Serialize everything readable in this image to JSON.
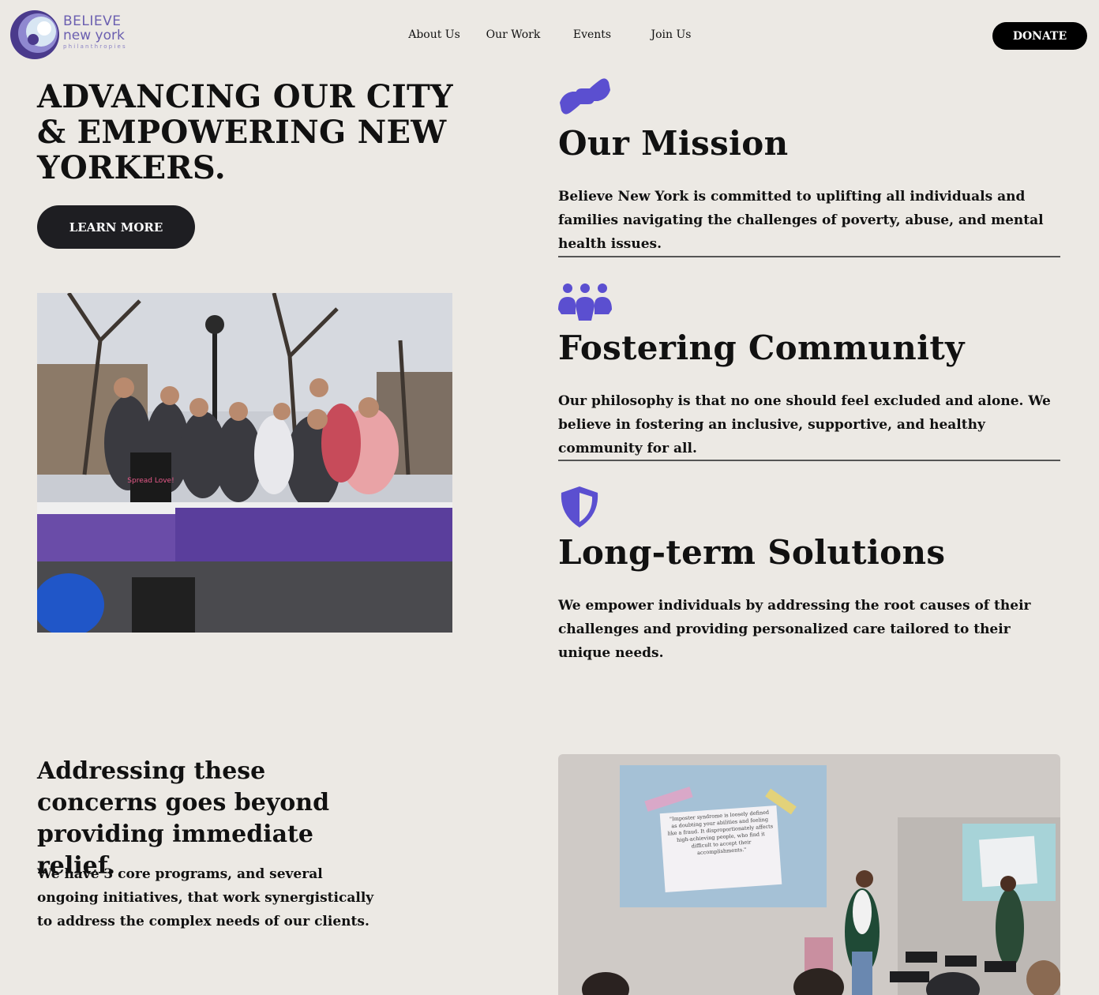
{
  "brand": {
    "line1": "BELIEVE",
    "line2": "new york",
    "line3": "philanthropies",
    "accent_color": "#6b5fb0",
    "icon_color": "#5b4fd0"
  },
  "nav": {
    "items": [
      {
        "label": "About Us"
      },
      {
        "label": "Our Work"
      },
      {
        "label": "Events"
      },
      {
        "label": "Join Us"
      }
    ],
    "donate_label": "DONATE"
  },
  "hero": {
    "title": "ADVANCING OUR CITY & EMPOWERING NEW YORKERS.",
    "button_label": "LEARN MORE",
    "photo_icon": "group-photo-image",
    "sign_text": "Spread Love!"
  },
  "features": [
    {
      "icon": "handshake-icon",
      "title": "Our Mission",
      "body": "Believe New York is committed to uplifting all individuals and families navigating the challenges of poverty, abuse, and mental health issues."
    },
    {
      "icon": "community-icon",
      "title": "Fostering Community",
      "body": "Our philosophy is that no one should feel excluded and alone. We believe in fostering an inclusive, supportive, and healthy community for all."
    },
    {
      "icon": "shield-icon",
      "title": "Long-term Solutions",
      "body": "We empower individuals by addressing the root causes of their challenges and providing personalized care tailored to their unique needs."
    }
  ],
  "concerns": {
    "title": "Addressing these concerns goes beyond providing immediate relief.",
    "body": "We have 3 core programs, and several ongoing initiatives, that work synergistically to address the complex needs of our clients.",
    "photo_icon": "workshop-photo-image",
    "slide_text": "\"Imposter syndrome is loosely defined as doubting your abilities and feeling like a fraud. It disproportionately affects high-achieving people, who find it difficult to accept their accomplishments.\""
  }
}
